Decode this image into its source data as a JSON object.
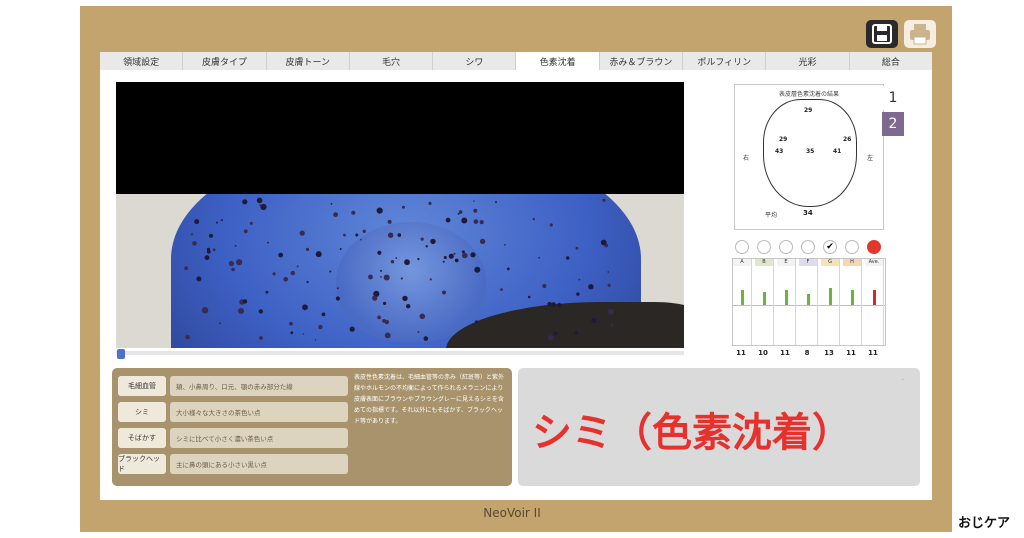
{
  "toolbar": {
    "save_icon": "save-icon",
    "print_icon": "print-icon"
  },
  "tabs": [
    {
      "label": "領域設定"
    },
    {
      "label": "皮膚タイプ"
    },
    {
      "label": "皮膚トーン"
    },
    {
      "label": "毛穴"
    },
    {
      "label": "シワ"
    },
    {
      "label": "色素沈着",
      "active": true
    },
    {
      "label": "赤み＆ブラウン"
    },
    {
      "label": "ポルフィリン"
    },
    {
      "label": "光彩"
    },
    {
      "label": "総合"
    }
  ],
  "face_map": {
    "title": "表皮層色素沈着の結果",
    "values": [
      "29",
      "29",
      "26",
      "43",
      "35",
      "41"
    ],
    "right_label": "右",
    "left_label": "左",
    "avg_label": "平均",
    "avg_value": "34"
  },
  "pages": [
    "1",
    "2"
  ],
  "chart_data": {
    "type": "bar",
    "categories": [
      "A",
      "B",
      "E",
      "F",
      "G",
      "H",
      "Ave."
    ],
    "values": [
      11,
      10,
      11,
      8,
      13,
      11,
      11
    ],
    "colors": [
      "#6bb33b",
      "#6bb33b",
      "#6bb33b",
      "#6bb33b",
      "#6bb33b",
      "#6bb33b",
      "#d12a2a"
    ],
    "ylim": [
      0,
      30
    ]
  },
  "glossary": [
    {
      "term": "毛細血管",
      "def": "頬、小鼻周り、口元、顎の赤み部分た線"
    },
    {
      "term": "シミ",
      "def": "大小様々な大きさの茶色い点"
    },
    {
      "term": "そばかす",
      "def": "シミに比べて小さく濃い茶色い点"
    },
    {
      "term": "ブラックヘッド",
      "def": "主に鼻の頭にある小さい黒い点"
    }
  ],
  "description": "表皮性色素沈着は、毛細血管等の赤み（紅斑等）と紫外線やホルモンの不均衡によって作られるメラニンにより皮膚表面にブラウンやブラウングレーに見えるシミを含めての指標です。それ以外にもそばかす、ブラックヘッド等があります。",
  "result": {
    "label": "シミ（色素沈着）",
    "dot": "."
  },
  "brand": "NeoVoir II",
  "watermark": "おじケア"
}
